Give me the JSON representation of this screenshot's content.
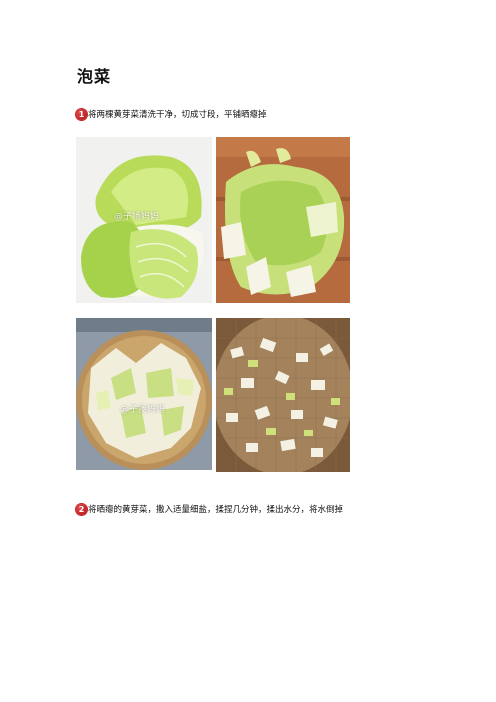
{
  "title": "泡菜",
  "steps": [
    {
      "num": "1",
      "text": "将两棵黄芽菜清洗干净，切成寸段，平铺晒瘪掉"
    },
    {
      "num": "2",
      "text": "将晒瘪的黄芽菜，撒入适量细盐，揉捏几分钟，揉出水分，将水倒掉"
    }
  ],
  "photos": [
    {
      "name": "whole-cabbage-photo",
      "watermark": "@子扬妈妈"
    },
    {
      "name": "cut-cabbage-photo",
      "watermark": ""
    },
    {
      "name": "basket-cabbage-photo",
      "watermark": "@子扬妈妈"
    },
    {
      "name": "drying-rack-photo",
      "watermark": ""
    }
  ]
}
